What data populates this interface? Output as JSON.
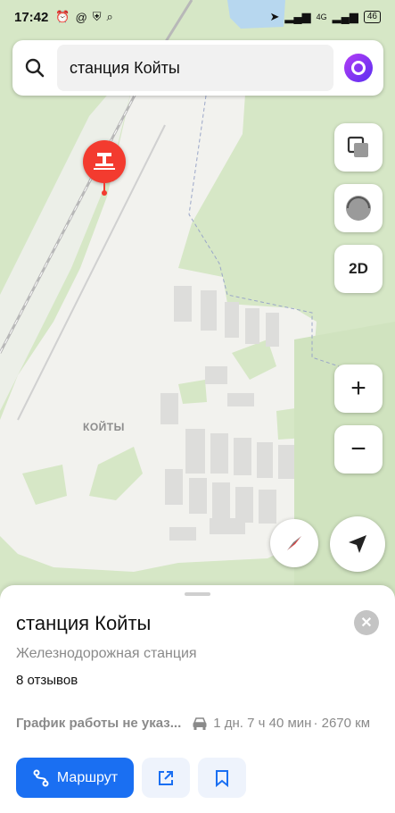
{
  "status_bar": {
    "time": "17:42",
    "network": "4G",
    "battery": "46"
  },
  "search": {
    "query": "станция Койты"
  },
  "map": {
    "place_label": "КОЙТЫ",
    "controls": {
      "mode_2d": "2D",
      "zoom_in": "+",
      "zoom_out": "−"
    }
  },
  "place_card": {
    "title": "станция Койты",
    "category": "Железнодорожная станция",
    "reviews": "8 отзывов",
    "hours": "График работы не указ...",
    "travel_time": "1 дн. 7 ч 40 мин",
    "distance": "· 2670 км",
    "route_label": "Маршрут"
  },
  "colors": {
    "accent": "#1a6ff2",
    "pin": "#f33b2f"
  }
}
